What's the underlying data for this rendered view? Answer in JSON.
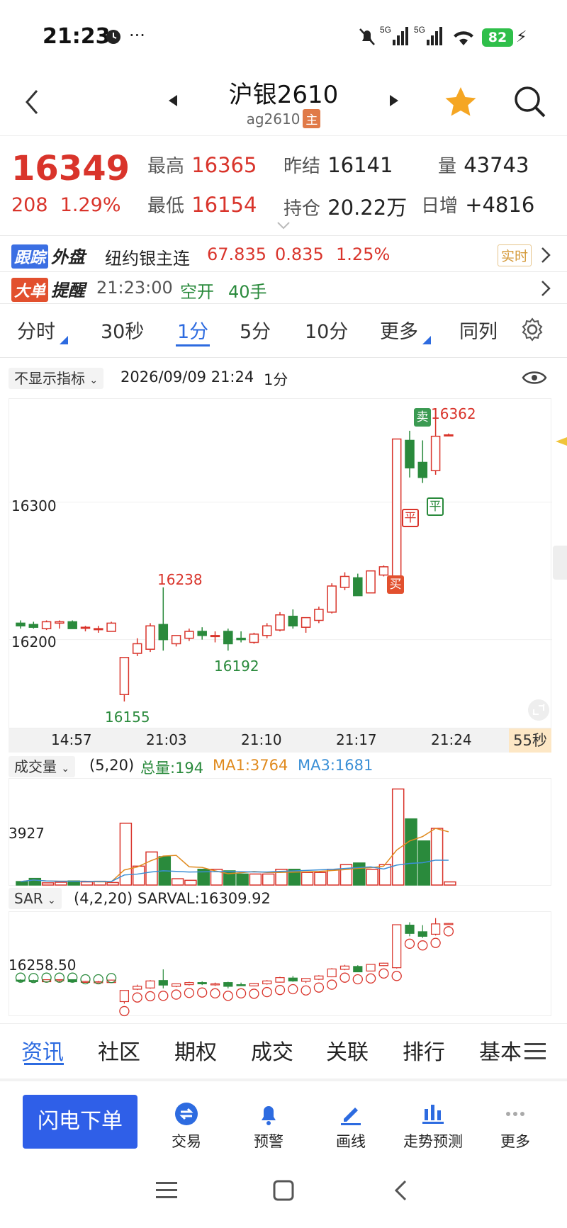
{
  "status": {
    "time": "21:23",
    "battery": "82"
  },
  "header": {
    "title": "沪银2610",
    "code": "ag2610",
    "main_tag": "主"
  },
  "quote": {
    "price": "16349",
    "change": "208",
    "change_pct": "1.29%",
    "high_label": "最高",
    "high": "16365",
    "low_label": "最低",
    "low": "16154",
    "prev_label": "昨结",
    "prev": "16141",
    "oi_label": "持仓",
    "oi": "20.22万",
    "vol_label": "量",
    "vol": "43743",
    "daily_inc_label": "日增",
    "daily_inc": "+4816"
  },
  "track": {
    "tag1": "跟踪",
    "tag2": "外盘",
    "name": "纽约银主连",
    "price": "67.835",
    "chg": "0.835",
    "pct": "1.25%",
    "realtime": "实时"
  },
  "alert": {
    "tag1": "大单",
    "tag2": "提醒",
    "time": "21:23:00",
    "type": "空开",
    "qty": "40手"
  },
  "tabs": [
    "分时",
    "30秒",
    "1分",
    "5分",
    "10分",
    "更多",
    "同列"
  ],
  "chart_header": {
    "indicator": "不显示指标",
    "datetime": "2026/09/09 21:24",
    "period": "1分"
  },
  "main_chart": {
    "y_labels": [
      "16300",
      "16200"
    ],
    "x_labels": [
      "14:57",
      "21:03",
      "21:10",
      "21:17",
      "21:24"
    ],
    "annotations": {
      "high_top": "16362",
      "a1": "16238",
      "a2": "16192",
      "a3": "16155"
    },
    "markers": {
      "buy": "买",
      "sell": "卖",
      "close1": "平",
      "close2": "平"
    },
    "countdown": "55秒"
  },
  "volume": {
    "label": "成交量",
    "params": "(5,20)",
    "total_label": "总量:194",
    "ma1": "MA1:3764",
    "ma3": "MA3:1681",
    "y_label": "3927"
  },
  "sar": {
    "label": "SAR",
    "params": "(4,2,20)",
    "value": "SARVAL:16309.92",
    "y_label": "16258.50"
  },
  "bottom_tabs": [
    "资讯",
    "社区",
    "期权",
    "成交",
    "关联",
    "排行",
    "基本"
  ],
  "toolbar": {
    "flash": "闪电下单",
    "trade": "交易",
    "warn": "预警",
    "draw": "画线",
    "trend": "走势预测",
    "more": "更多"
  },
  "colors": {
    "up": "#d9342b",
    "down": "#2a8a3c",
    "accent": "#2d6be0"
  },
  "chart_data": {
    "type": "candlestick",
    "candles": [
      {
        "o": 16212,
        "h": 16214,
        "l": 16208,
        "c": 16210
      },
      {
        "o": 16211,
        "h": 16213,
        "l": 16208,
        "c": 16209
      },
      {
        "o": 16208,
        "h": 16214,
        "l": 16207,
        "c": 16213
      },
      {
        "o": 16212,
        "h": 16214,
        "l": 16208,
        "c": 16213
      },
      {
        "o": 16213,
        "h": 16214,
        "l": 16208,
        "c": 16208
      },
      {
        "o": 16209,
        "h": 16210,
        "l": 16206,
        "c": 16209
      },
      {
        "o": 16208,
        "h": 16210,
        "l": 16205,
        "c": 16208
      },
      {
        "o": 16206,
        "h": 16213,
        "l": 16206,
        "c": 16212
      },
      {
        "o": 16160,
        "h": 16187,
        "l": 16155,
        "c": 16187
      },
      {
        "o": 16190,
        "h": 16201,
        "l": 16188,
        "c": 16197
      },
      {
        "o": 16193,
        "h": 16212,
        "l": 16191,
        "c": 16210
      },
      {
        "o": 16211,
        "h": 16238,
        "l": 16192,
        "c": 16200
      },
      {
        "o": 16197,
        "h": 16200,
        "l": 16195,
        "c": 16203
      },
      {
        "o": 16201,
        "h": 16208,
        "l": 16199,
        "c": 16206
      },
      {
        "o": 16206,
        "h": 16209,
        "l": 16200,
        "c": 16203
      },
      {
        "o": 16203,
        "h": 16206,
        "l": 16198,
        "c": 16203
      },
      {
        "o": 16206,
        "h": 16208,
        "l": 16192,
        "c": 16197
      },
      {
        "o": 16201,
        "h": 16206,
        "l": 16198,
        "c": 16200
      },
      {
        "o": 16198,
        "h": 16205,
        "l": 16197,
        "c": 16204
      },
      {
        "o": 16203,
        "h": 16212,
        "l": 16201,
        "c": 16210
      },
      {
        "o": 16207,
        "h": 16220,
        "l": 16206,
        "c": 16218
      },
      {
        "o": 16217,
        "h": 16222,
        "l": 16208,
        "c": 16210
      },
      {
        "o": 16209,
        "h": 16216,
        "l": 16205,
        "c": 16216
      },
      {
        "o": 16214,
        "h": 16224,
        "l": 16212,
        "c": 16222
      },
      {
        "o": 16220,
        "h": 16241,
        "l": 16219,
        "c": 16239
      },
      {
        "o": 16238,
        "h": 16249,
        "l": 16236,
        "c": 16246
      },
      {
        "o": 16245,
        "h": 16248,
        "l": 16232,
        "c": 16232
      },
      {
        "o": 16234,
        "h": 16250,
        "l": 16234,
        "c": 16250
      },
      {
        "o": 16247,
        "h": 16254,
        "l": 16246,
        "c": 16253
      },
      {
        "o": 16242,
        "h": 16346,
        "l": 16240,
        "c": 16346
      },
      {
        "o": 16345,
        "h": 16352,
        "l": 16318,
        "c": 16325
      },
      {
        "o": 16329,
        "h": 16345,
        "l": 16314,
        "c": 16318
      },
      {
        "o": 16323,
        "h": 16362,
        "l": 16320,
        "c": 16348
      },
      {
        "o": 16349,
        "h": 16350,
        "l": 16348,
        "c": 16349
      }
    ],
    "volumes": [
      220,
      420,
      140,
      180,
      260,
      200,
      240,
      160,
      3927,
      1200,
      2100,
      1800,
      400,
      300,
      1000,
      1000,
      900,
      700,
      700,
      700,
      1000,
      1000,
      800,
      800,
      1000,
      1300,
      1400,
      1000,
      1300,
      6100,
      4200,
      2800,
      3600,
      200
    ]
  }
}
